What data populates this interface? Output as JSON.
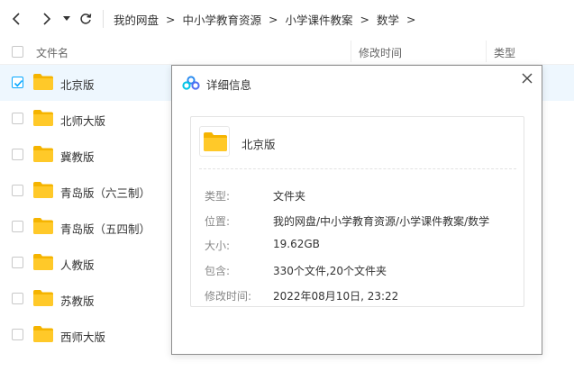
{
  "nav": {
    "back_icon": "chevron-left-icon",
    "forward_icon": "chevron-right-icon",
    "dropdown_icon": "caret-down-icon",
    "refresh_icon": "refresh-icon",
    "breadcrumb": [
      "我的网盘",
      "中小学教育资源",
      "小学课件教案",
      "数学"
    ],
    "separator": ">"
  },
  "columns": {
    "name": "文件名",
    "modified": "修改时间",
    "type": "类型"
  },
  "files": [
    {
      "name": "北京版",
      "selected": true
    },
    {
      "name": "北师大版",
      "selected": false
    },
    {
      "name": "冀教版",
      "selected": false
    },
    {
      "name": "青岛版（六三制）",
      "selected": false
    },
    {
      "name": "青岛版（五四制）",
      "selected": false
    },
    {
      "name": "人教版",
      "selected": false
    },
    {
      "name": "苏教版",
      "selected": false
    },
    {
      "name": "西师大版",
      "selected": false
    }
  ],
  "dialog": {
    "title": "详细信息",
    "close_icon": "close-icon",
    "file_name": "北京版",
    "info": [
      {
        "key": "类型:",
        "value": "文件夹"
      },
      {
        "key": "位置:",
        "value": "我的网盘/中小学教育资源/小学课件教案/数学"
      },
      {
        "key": "大小:",
        "value": "19.62GB"
      },
      {
        "key": "包含:",
        "value": "330个文件,20个文件夹"
      },
      {
        "key": "修改时间:",
        "value": "2022年08月10日, 23:22"
      }
    ]
  },
  "colors": {
    "folder": "#ffc929",
    "folder_tab": "#f5b400",
    "accent": "#06a7ff",
    "selected_row": "#eef7fe"
  }
}
